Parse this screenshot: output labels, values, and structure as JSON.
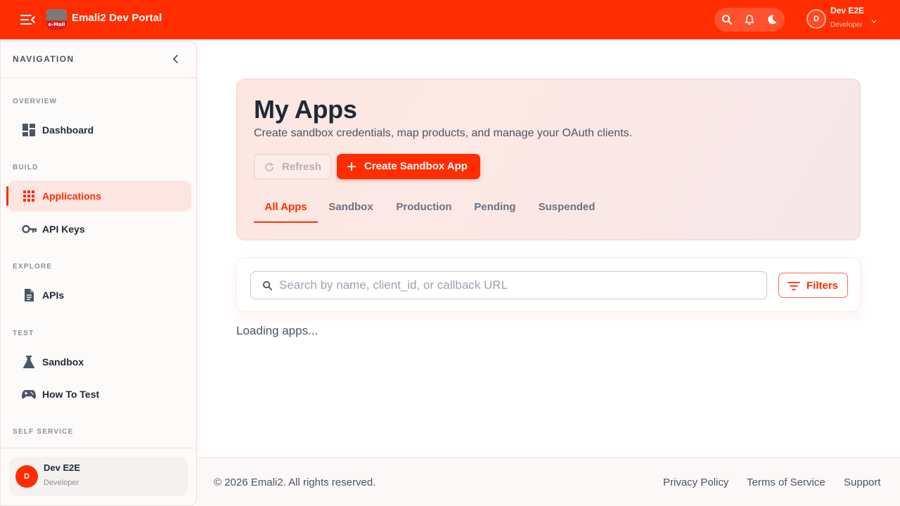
{
  "header": {
    "app_title": "Emali2 Dev Portal",
    "logo_text": "e-Mali",
    "icons": [
      "menu-collapse-icon",
      "search-icon",
      "bell-icon",
      "moon-icon",
      "chevron-down-icon"
    ],
    "user": {
      "initial": "D",
      "name": "Dev E2E",
      "role": "Developer"
    }
  },
  "sidebar": {
    "title": "NAVIGATION",
    "sections": {
      "overview": "OVERVIEW",
      "build": "BUILD",
      "explore": "EXPLORE",
      "test": "TEST",
      "self_service": "SELF SERVICE"
    },
    "items": {
      "dashboard": {
        "label": "Dashboard",
        "icon": "dashboard-icon"
      },
      "applications": {
        "label": "Applications",
        "icon": "grid-icon",
        "active": true
      },
      "api_keys": {
        "label": "API Keys",
        "icon": "key-icon"
      },
      "apis": {
        "label": "APIs",
        "icon": "document-icon"
      },
      "sandbox": {
        "label": "Sandbox",
        "icon": "flask-icon"
      },
      "how_to_test": {
        "label": "How To Test",
        "icon": "gamepad-icon"
      }
    },
    "footer_user": {
      "initial": "D",
      "name": "Dev E2E",
      "role": "Developer"
    }
  },
  "main": {
    "title": "My Apps",
    "subtitle": "Create sandbox credentials, map products, and manage your OAuth clients.",
    "refresh_label": "Refresh",
    "create_label": "Create Sandbox App",
    "tabs": [
      "All Apps",
      "Sandbox",
      "Production",
      "Pending",
      "Suspended"
    ],
    "active_tab": "All Apps",
    "search": {
      "placeholder": "Search by name, client_id, or callback URL",
      "value": ""
    },
    "filters_label": "Filters",
    "loading_text": "Loading apps..."
  },
  "footer": {
    "copyright": "© 2026 Emali2. All rights reserved.",
    "links": [
      "Privacy Policy",
      "Terms of Service",
      "Support"
    ]
  },
  "colors": {
    "accent": "#ff2d00",
    "text": "#1f2937",
    "muted": "#6b7280"
  }
}
